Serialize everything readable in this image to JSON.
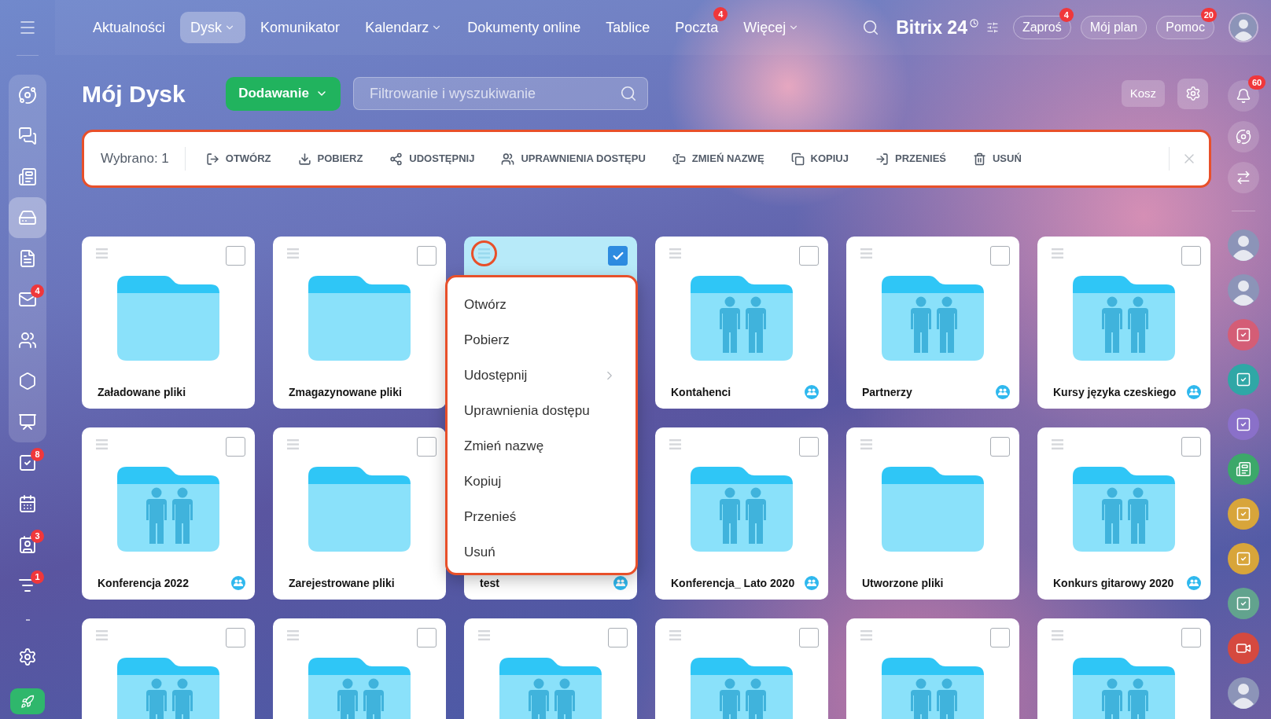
{
  "left_sidebar": {
    "group": [
      {
        "kind": "flow",
        "selected": false
      },
      {
        "kind": "chat",
        "selected": false
      },
      {
        "kind": "feed",
        "selected": false
      },
      {
        "kind": "drive",
        "selected": true
      },
      {
        "kind": "document",
        "selected": false
      },
      {
        "kind": "mail",
        "selected": false,
        "badge": "4"
      },
      {
        "kind": "people",
        "selected": false
      },
      {
        "kind": "hexagon",
        "selected": false
      },
      {
        "kind": "presentation",
        "selected": false
      }
    ],
    "items": [
      {
        "kind": "tasks",
        "selected": false,
        "badge": "8"
      },
      {
        "kind": "calendar",
        "selected": false
      },
      {
        "kind": "contacts",
        "selected": false,
        "badge": "3"
      },
      {
        "kind": "funnel",
        "selected": false,
        "badge": "1"
      }
    ],
    "footer": [
      {
        "kind": "settings"
      },
      {
        "kind": "rocket"
      }
    ]
  },
  "top_nav": {
    "items": [
      {
        "label": "Aktualności",
        "selected": false,
        "dropdown": false
      },
      {
        "label": "Dysk",
        "selected": true,
        "dropdown": true
      },
      {
        "label": "Komunikator",
        "selected": false,
        "dropdown": false
      },
      {
        "label": "Kalendarz",
        "selected": false,
        "dropdown": true
      },
      {
        "label": "Dokumenty online",
        "selected": false,
        "dropdown": false
      },
      {
        "label": "Tablice",
        "selected": false,
        "dropdown": false
      },
      {
        "label": "Poczta",
        "selected": false,
        "dropdown": false,
        "badge": "4"
      },
      {
        "label": "Więcej",
        "selected": false,
        "dropdown": true
      }
    ],
    "logo": "Bitrix 24",
    "buttons": [
      {
        "label": "Zaproś",
        "kind": "outline",
        "badge": "4"
      },
      {
        "label": "Mój plan",
        "kind": "filled"
      },
      {
        "label": "Pomoc",
        "kind": "filled",
        "badge": "20"
      }
    ]
  },
  "header": {
    "title": "Mój Dysk",
    "add_button": "Dodawanie",
    "search": {
      "placeholder": "Filtrowanie i wyszukiwanie"
    },
    "trash_button": "Kosz"
  },
  "selection_toolbar": {
    "highlighted": true,
    "count": "Wybrano: 1",
    "actions": [
      {
        "kind": "open",
        "label": "OTWÓRZ"
      },
      {
        "kind": "download",
        "label": "POBIERZ"
      },
      {
        "kind": "share",
        "label": "UDOSTĘPNIJ"
      },
      {
        "kind": "permissions",
        "label": "UPRAWNIENIA DOSTĘPU"
      },
      {
        "kind": "rename",
        "label": "ZMIEŃ NAZWĘ"
      },
      {
        "kind": "copy",
        "label": "KOPIUJ"
      },
      {
        "kind": "move",
        "label": "PRZENIEŚ"
      },
      {
        "kind": "delete",
        "label": "USUŃ"
      }
    ]
  },
  "cards": [
    {
      "name": "Załadowane pliki",
      "shared": false,
      "selected": false,
      "checked": false
    },
    {
      "name": "Zmagazynowane pliki",
      "shared": false,
      "selected": false,
      "checked": false
    },
    {
      "selected": true,
      "checked": true,
      "highlighted": true
    },
    {
      "name": "Kontahenci",
      "shared": true,
      "selected": false,
      "checked": false
    },
    {
      "name": "Partnerzy",
      "shared": true,
      "selected": false,
      "checked": false
    },
    {
      "name": "Kursy języka czeskiego",
      "shared": true,
      "selected": false,
      "checked": false
    },
    {
      "name": "Konferencja 2022",
      "shared": true,
      "selected": false,
      "checked": false
    },
    {
      "name": "Zarejestrowane pliki",
      "shared": false,
      "selected": false,
      "checked": false
    },
    {
      "name": "test",
      "shared": true,
      "selected": false
    },
    {
      "name": "Konferencja_ Lato 2020",
      "shared": true,
      "selected": false,
      "checked": false
    },
    {
      "name": "Utworzone pliki",
      "shared": false,
      "selected": false,
      "checked": false
    },
    {
      "name": "Konkurs gitarowy 2020",
      "shared": true,
      "selected": false,
      "checked": false
    },
    {
      "shared": true,
      "selected": false,
      "checked": false
    },
    {
      "shared": true,
      "selected": false,
      "checked": false
    },
    {
      "shared": true,
      "selected": false,
      "checked": false
    },
    {
      "shared": true,
      "selected": false,
      "checked": false
    },
    {
      "shared": true,
      "selected": false,
      "checked": false
    },
    {
      "shared": true,
      "selected": false,
      "checked": false
    }
  ],
  "context_menu": {
    "highlighted": true,
    "items": [
      {
        "label": "Otwórz",
        "submenu": false
      },
      {
        "label": "Pobierz",
        "submenu": false
      },
      {
        "label": "Udostępnij",
        "submenu": true
      },
      {
        "label": "Uprawnienia dostępu",
        "submenu": false
      },
      {
        "label": "Zmień nazwę",
        "submenu": false
      },
      {
        "label": "Kopiuj",
        "submenu": false
      },
      {
        "label": "Przenieś",
        "submenu": false
      },
      {
        "label": "Usuń",
        "submenu": false
      }
    ]
  },
  "right_sidebar": {
    "top": [
      {
        "kind": "bell",
        "badge": "60"
      },
      {
        "kind": "copilot"
      },
      {
        "kind": "chat"
      }
    ],
    "items": [
      {
        "kind": "avatar"
      },
      {
        "kind": "avatar"
      },
      {
        "kind": "task",
        "color": "#d45d76"
      },
      {
        "kind": "task",
        "color": "#2fa7a6"
      },
      {
        "kind": "task",
        "color": "#8a70c9"
      },
      {
        "kind": "news",
        "color": "#3ca86a"
      },
      {
        "kind": "task",
        "color": "#d8a53a"
      },
      {
        "kind": "task",
        "color": "#d8a53a"
      },
      {
        "kind": "task",
        "color": "#62a38e"
      },
      {
        "kind": "video",
        "color": "#d5493f"
      },
      {
        "kind": "avatar"
      }
    ]
  }
}
